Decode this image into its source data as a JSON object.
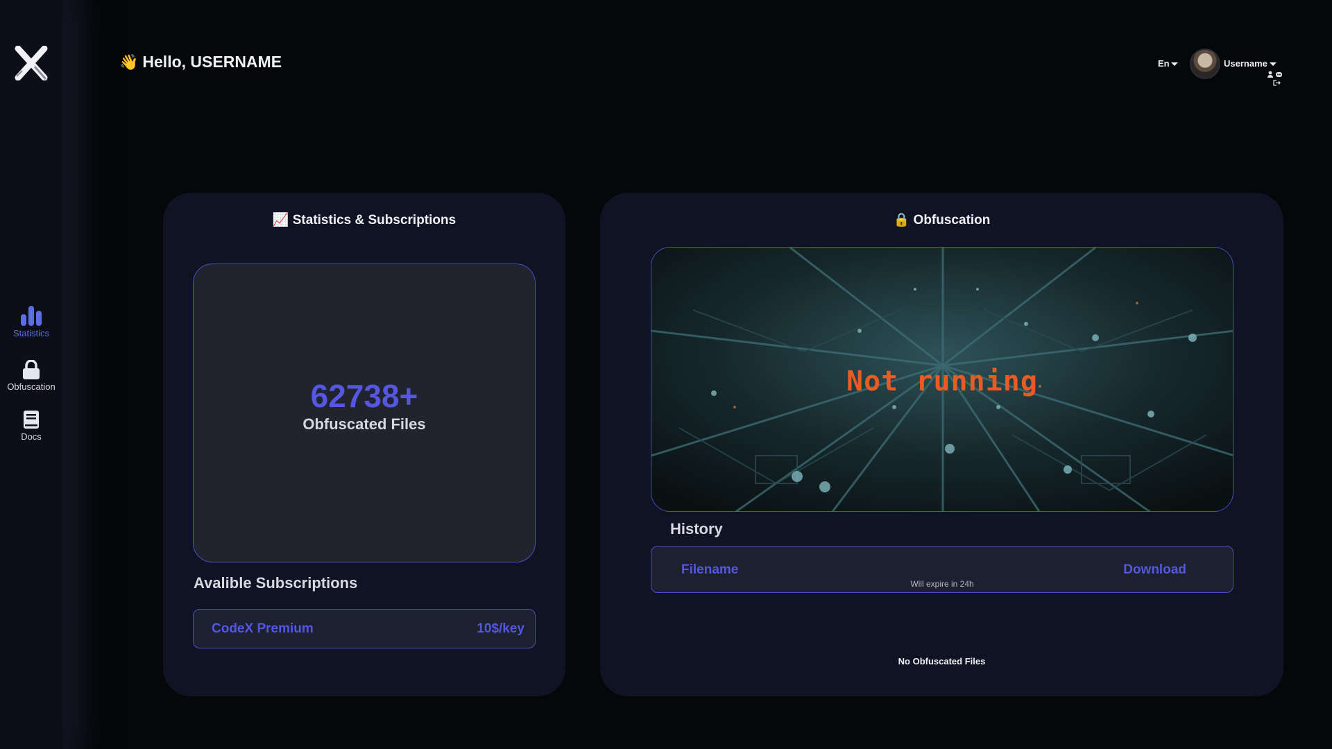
{
  "sidebar": {
    "items": [
      {
        "label": "Statistics",
        "icon": "bar-chart-icon",
        "active": true
      },
      {
        "label": "Obfuscation",
        "icon": "lock-icon"
      },
      {
        "label": "Docs",
        "icon": "book-icon"
      }
    ]
  },
  "header": {
    "greeting": "Hello, USERNAME",
    "greeting_icon": "👋",
    "language": "En",
    "username": "Username"
  },
  "stats_card": {
    "title_icon": "📈",
    "title": "Statistics & Subscriptions",
    "count": "62738+",
    "count_label": "Obfuscated Files",
    "subscriptions_heading": "Avalible Subscriptions",
    "subscriptions": [
      {
        "name": "CodeX Premium",
        "price": "10$/key"
      }
    ]
  },
  "obf_card": {
    "title_icon": "🔒",
    "title": "Obfuscation",
    "status": "Not running",
    "history_heading": "History",
    "history_columns": {
      "filename": "Filename",
      "download": "Download"
    },
    "expire_note": "Will expire in 24h",
    "empty_text": "No Obfuscated Files"
  },
  "colors": {
    "accent": "#5557e0",
    "status": "#e85b23",
    "card_bg": "#0f1324",
    "page_bg": "#060709"
  }
}
